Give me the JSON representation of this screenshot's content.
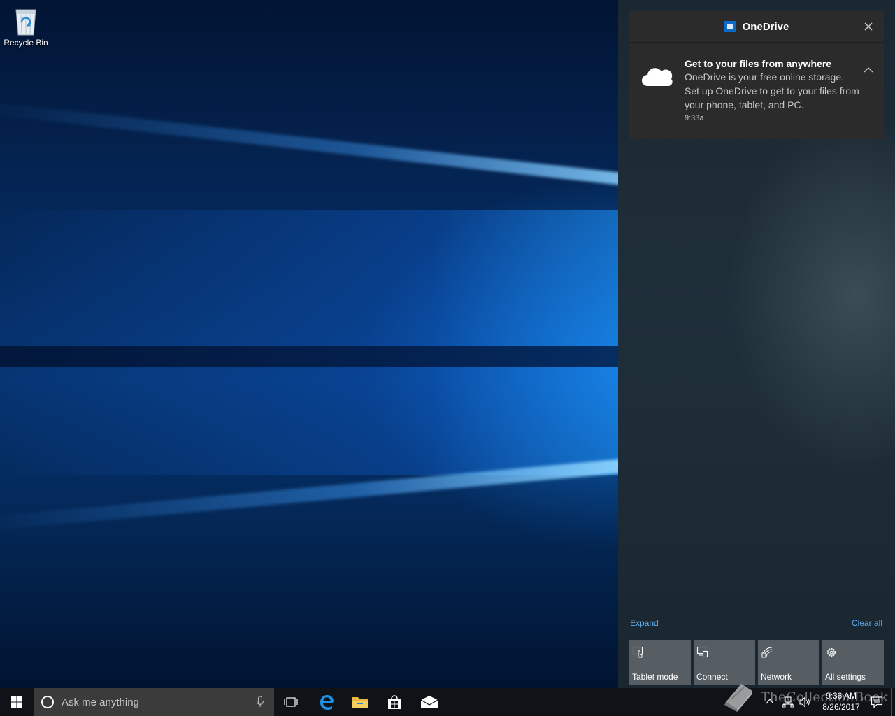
{
  "desktop": {
    "recycle_bin_label": "Recycle Bin"
  },
  "action_center": {
    "notification": {
      "app_name": "OneDrive",
      "title": "Get to your files from anywhere",
      "message": "OneDrive is your free online storage. Set up OneDrive to get to your files from your phone, tablet, and PC.",
      "time": "9:33a"
    },
    "expand_label": "Expand",
    "clear_all_label": "Clear all",
    "quick_actions": [
      {
        "label": "Tablet mode",
        "icon": "tablet-mode-icon"
      },
      {
        "label": "Connect",
        "icon": "connect-icon"
      },
      {
        "label": "Network",
        "icon": "network-icon"
      },
      {
        "label": "All settings",
        "icon": "gear-icon"
      }
    ]
  },
  "taskbar": {
    "search_placeholder": "Ask me anything",
    "pinned": [
      "task-view-icon",
      "edge-icon",
      "file-explorer-icon",
      "store-icon",
      "mail-icon"
    ],
    "clock_time": "9:36 AM",
    "clock_date": "8/26/2017"
  },
  "watermark": {
    "text": "TheCollectionBook"
  },
  "colors": {
    "accent": "#0b6cc8",
    "link": "#5fb0f2",
    "tile": "#565d63",
    "taskbar": "#0f1217"
  }
}
